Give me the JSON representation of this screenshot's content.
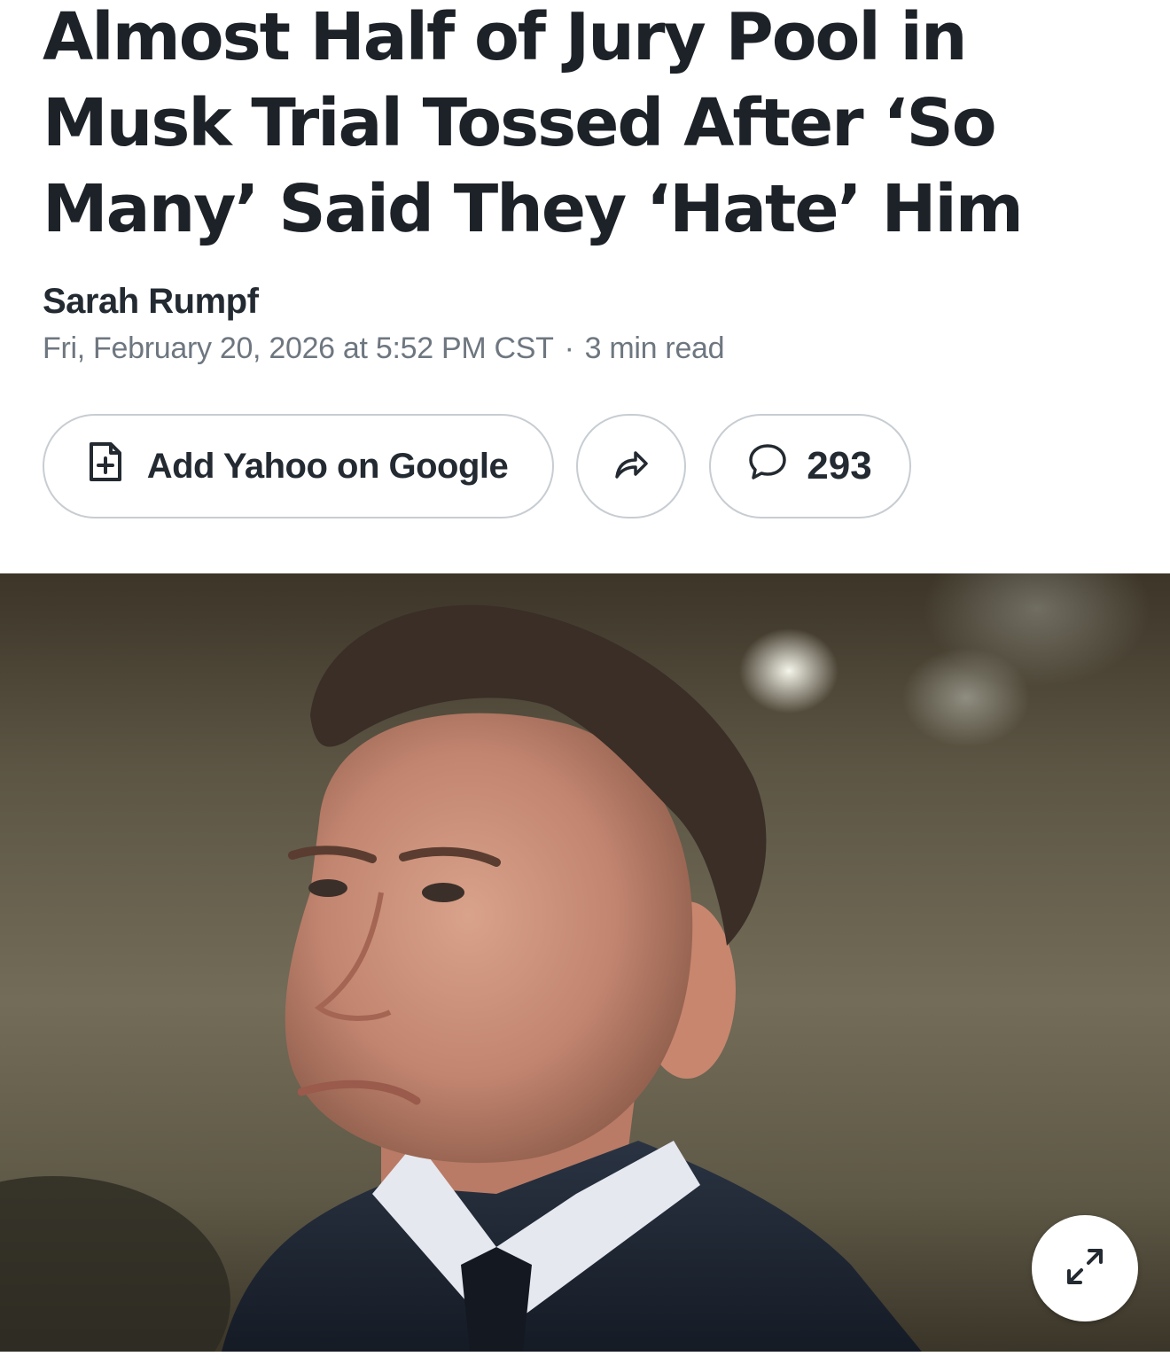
{
  "article": {
    "headline": "Almost Half of Jury Pool in Musk Trial Tossed After ‘So Many’ Said They ‘Hate’ Him",
    "author": "Sarah Rumpf",
    "date": "Fri, February 20, 2026 at 5:52 PM CST",
    "read_time": "3 min read"
  },
  "actions": {
    "add_google_label": "Add Yahoo on Google",
    "comment_count": "293"
  },
  "icons": {
    "add_google": "document-plus-icon",
    "share": "share-arrow-icon",
    "comment": "speech-bubble-icon",
    "expand": "expand-arrows-icon"
  }
}
